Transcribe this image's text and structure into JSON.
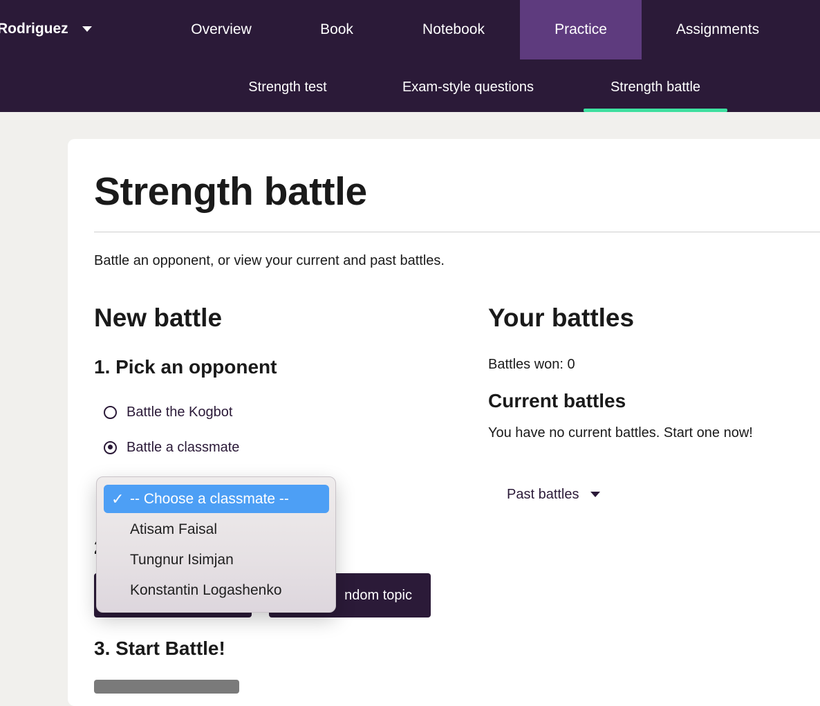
{
  "header": {
    "user_name": "Rodriguez",
    "nav": [
      {
        "label": "Overview",
        "active": false
      },
      {
        "label": "Book",
        "active": false
      },
      {
        "label": "Notebook",
        "active": false
      },
      {
        "label": "Practice",
        "active": true
      },
      {
        "label": "Assignments",
        "active": false
      }
    ],
    "subnav": [
      {
        "label": "Strength test",
        "active": false
      },
      {
        "label": "Exam-style questions",
        "active": false
      },
      {
        "label": "Strength battle",
        "active": true
      }
    ],
    "colors": {
      "bar": "#2b1a38",
      "active": "#5e3b7e",
      "underline": "#3ee0a0"
    }
  },
  "page": {
    "title": "Strength battle",
    "intro": "Battle an opponent, or view your current and past battles."
  },
  "new_battle": {
    "heading": "New battle",
    "step1": "1. Pick an opponent",
    "options": [
      {
        "label": "Battle the Kogbot",
        "checked": false
      },
      {
        "label": "Battle a classmate",
        "checked": true
      }
    ],
    "step2_partial": "2",
    "random_topic_label": "ndom topic",
    "step3": "3. Start Battle!"
  },
  "classmate_select": {
    "options": [
      "-- Choose a classmate --",
      "Atisam Faisal",
      "Tungnur Isimjan",
      "Konstantin Logashenko"
    ],
    "selected": "-- Choose a classmate --",
    "check_icon": "checkmark-icon",
    "highlight_color": "#4d9ff5"
  },
  "your_battles": {
    "heading": "Your battles",
    "battles_won": "Battles won: 0",
    "current_heading": "Current battles",
    "current_empty": "You have no current battles. Start one now!",
    "past_label": "Past battles"
  }
}
